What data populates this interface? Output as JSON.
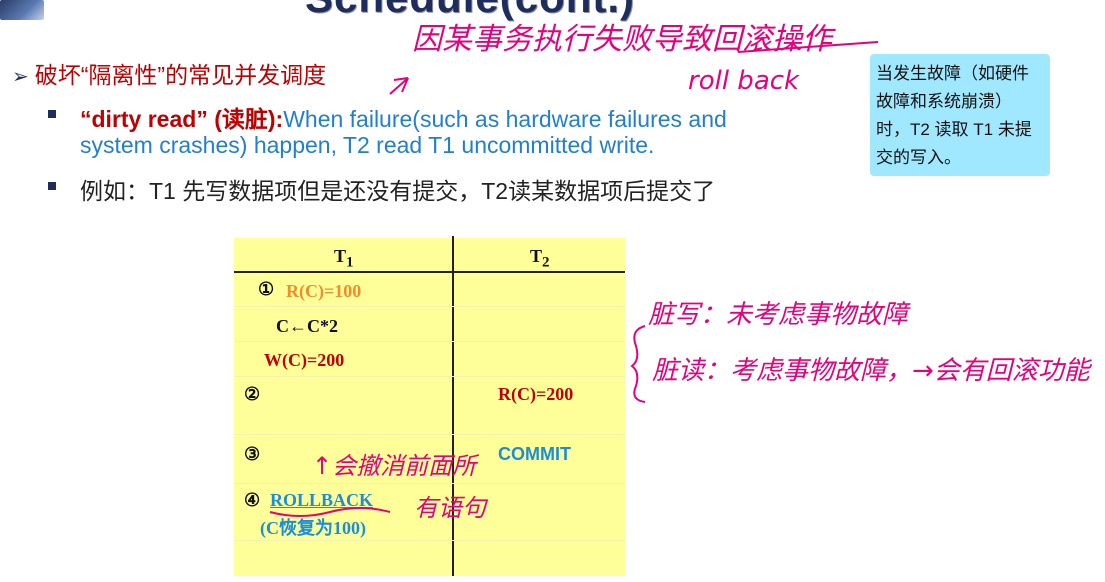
{
  "slide": {
    "title": "Schedule(cont.)",
    "bullet1": "破坏“隔离性”的常见并发调度",
    "dirty_label": "“dirty read” (读脏):",
    "dirty_text_a": "When failure(such as hardware failures and",
    "dirty_text_b": "system crashes) happen, T2 read T1 uncommitted write.",
    "example": "例如：T1 先写数据项但是还没有提交，T2读某数据项后提交了",
    "note": "当发生故障（如硬件故障和系统崩溃）时，T2 读取 T1 未提交的写入。"
  },
  "table": {
    "col1": "T",
    "col1_sub": "1",
    "col2": "T",
    "col2_sub": "2",
    "r1_num": "①",
    "r1": "R(C)=100",
    "r2": "C←C*2",
    "r3": "W(C)=200",
    "r4_num": "②",
    "r4_t2": "R(C)=200",
    "r5_num": "③",
    "r5_t2": "COMMIT",
    "r6_num": "④",
    "r6": "ROLLBACK",
    "r6_note": "(C恢复为100)"
  },
  "annotations": {
    "a1": "因某事务执行失败导致回滚操作",
    "a2": "roll back",
    "a3": "脏写：未考虑事物故障",
    "a4": "脏读：考虑事物故障，→会有回滚功能",
    "a5": "↑会撤消前面所",
    "a6": "有语句"
  },
  "colors": {
    "accent": "#1f2d5a",
    "note_bg": "#9fe8ff",
    "table_bg": "#ffff99",
    "ink": "#e6007e"
  }
}
